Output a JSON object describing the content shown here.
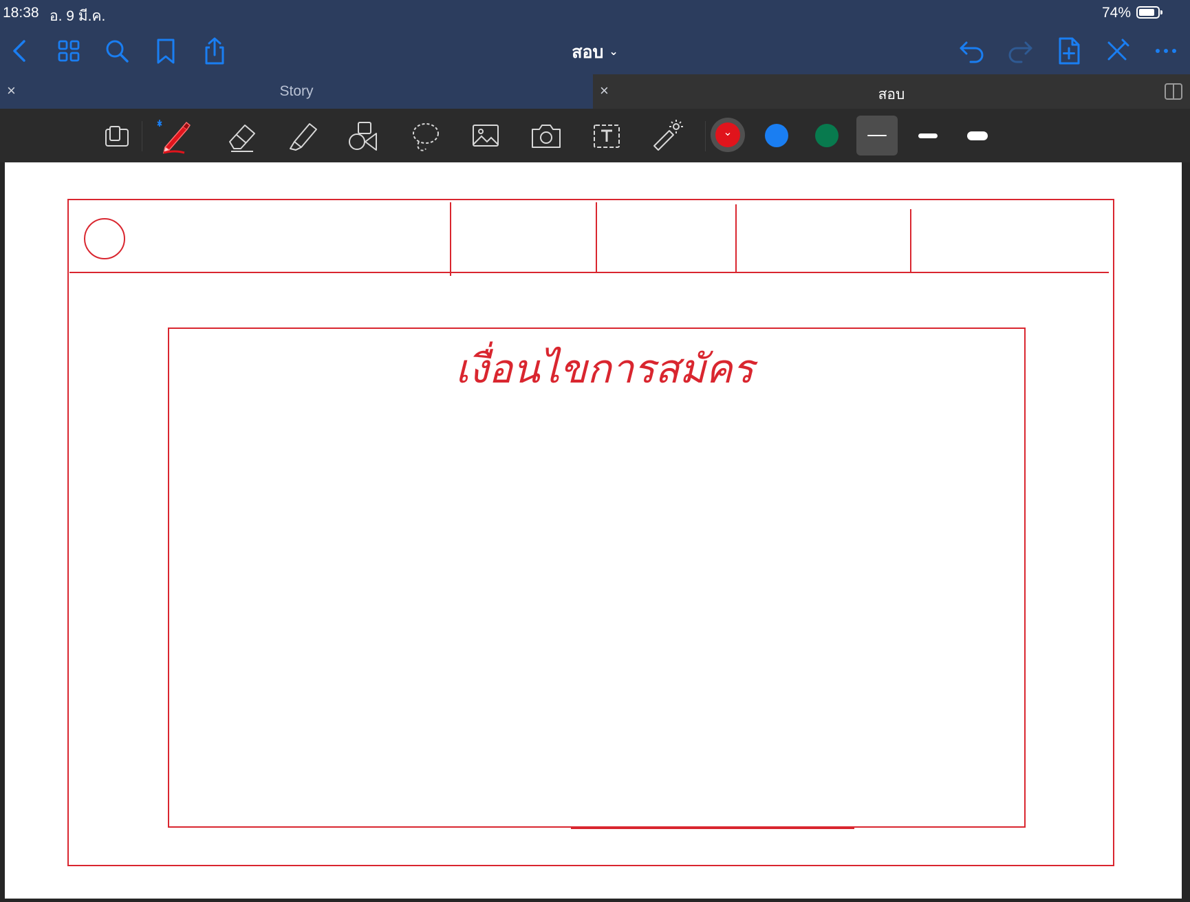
{
  "status_bar": {
    "time": "18:38",
    "date": "อ. 9 มี.ค.",
    "battery_percent": "74%",
    "battery_level": 0.74
  },
  "nav": {
    "document_title": "สอบ",
    "icons": {
      "back": "chevron-left-icon",
      "thumbnails": "grid-icon",
      "search": "search-icon",
      "bookmark": "bookmark-icon",
      "share": "share-icon",
      "undo": "undo-icon",
      "redo": "redo-icon",
      "add_page": "add-page-icon",
      "close_edit": "pen-close-icon",
      "more": "more-icon"
    }
  },
  "tabs": [
    {
      "label": "Story",
      "close": "×",
      "active": false
    },
    {
      "label": "สอบ",
      "close": "×",
      "active": true
    }
  ],
  "toolbar": {
    "tools": [
      "zoom-window",
      "pen",
      "eraser",
      "highlighter",
      "shapes",
      "lasso",
      "image",
      "camera",
      "text",
      "laser-pointer"
    ],
    "selected_tool": "pen",
    "colors": [
      "#e0141c",
      "#1a7ef2",
      "#087a4e"
    ],
    "selected_color": "#e0141c",
    "stroke_widths": [
      "thin",
      "medium",
      "thick"
    ],
    "selected_stroke": "thin",
    "selected_caret": "⌄"
  },
  "page": {
    "ink_color": "#d9262f",
    "handwritten_text": "เงื่อนไขการสมัคร"
  }
}
